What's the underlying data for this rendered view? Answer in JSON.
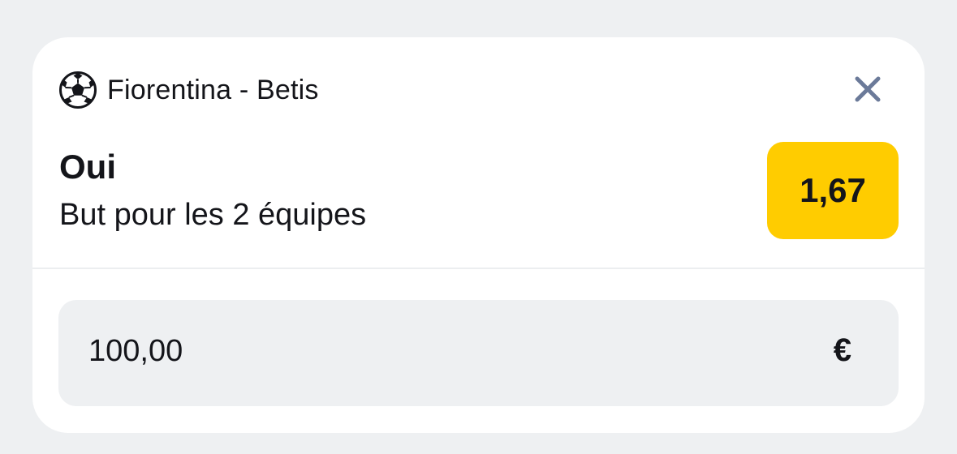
{
  "bet": {
    "sport_icon": "soccer-ball-icon",
    "match": "Fiorentina - Betis",
    "close_icon": "close-icon",
    "selection": "Oui",
    "market": "But pour les 2 équipes",
    "odds": "1,67"
  },
  "stake": {
    "value": "100,00",
    "currency": "€"
  },
  "colors": {
    "page_background": "#eef0f2",
    "card_background": "#ffffff",
    "odds_background": "#ffcc00",
    "close_icon": "#6b7a99",
    "text": "#14151a"
  }
}
